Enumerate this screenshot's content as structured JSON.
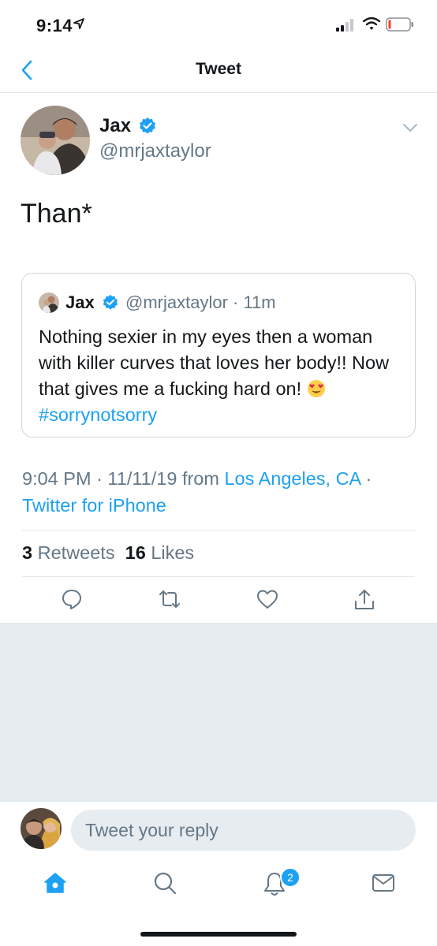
{
  "status_bar": {
    "time": "9:14"
  },
  "header": {
    "title": "Tweet"
  },
  "tweet": {
    "author_name": "Jax",
    "author_handle": "@mrjaxtaylor",
    "text": "Than*"
  },
  "quoted_tweet": {
    "author_name": "Jax",
    "author_handle": "@mrjaxtaylor",
    "age": "· 11m",
    "text_before_emoji": "Nothing sexier in my eyes then a woman with killer curves that loves her body!! Now that gives me a fucking hard on!",
    "text_after_emoji": "#sorrynotsorry",
    "emoji": "heart-eyes-emoji"
  },
  "meta": {
    "time": "9:04 PM",
    "separator": "·",
    "date": "11/11/19",
    "from_label": "from",
    "location": "Los Angeles, CA",
    "source": "Twitter for iPhone"
  },
  "stats": {
    "retweets_count": "3",
    "retweets_label": "Retweets",
    "likes_count": "16",
    "likes_label": "Likes"
  },
  "actions": [
    "reply-icon",
    "retweet-icon",
    "like-icon",
    "share-icon"
  ],
  "reply_bar": {
    "placeholder": "Tweet your reply"
  },
  "tabbar": {
    "tabs": [
      "home-icon",
      "search-icon",
      "notifications-icon",
      "messages-icon"
    ],
    "notifications_badge": "2"
  },
  "colors": {
    "accent": "#1da1f2",
    "secondary_text": "#657786",
    "divider": "#e1e8ed",
    "background_gray": "#e6ecf0"
  }
}
